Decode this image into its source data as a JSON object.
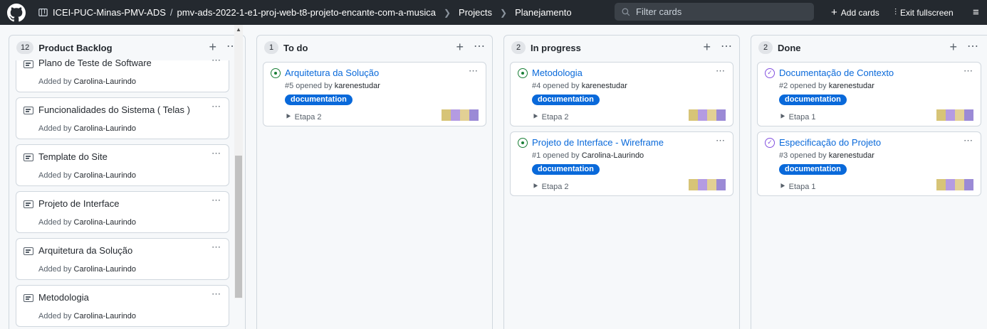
{
  "header": {
    "org": "ICEI-PUC-Minas-PMV-ADS",
    "separator": "/",
    "repo": "pmv-ads-2022-1-e1-proj-web-t8-projeto-encante-com-a-musica",
    "section": "Projects",
    "board": "Planejamento",
    "filter_placeholder": "Filter cards",
    "add_cards": "Add cards",
    "exit_fullscreen": "Exit fullscreen"
  },
  "icons": {
    "logo": "github-logo-icon",
    "project": "project-icon",
    "search": "search-icon",
    "plus": "plus-icon",
    "exit": "exit-fullscreen-icon",
    "menu": "menu-icon"
  },
  "colors": {
    "header_bg": "#24292f",
    "link_blue": "#0969da",
    "open_green": "#1a7f37",
    "closed_purple": "#8250df",
    "label_bg": "#0969da"
  },
  "columns": [
    {
      "count": "12",
      "title": "Product Backlog",
      "notes": [
        {
          "title": "Plano de Teste de Software",
          "added": "Added by",
          "author": "Carolina-Laurindo"
        },
        {
          "title": "Funcionalidades do Sistema ( Telas )",
          "added": "Added by",
          "author": "Carolina-Laurindo"
        },
        {
          "title": "Template do Site",
          "added": "Added by",
          "author": "Carolina-Laurindo"
        },
        {
          "title": "Projeto de Interface",
          "added": "Added by",
          "author": "Carolina-Laurindo"
        },
        {
          "title": "Arquitetura da Solução",
          "added": "Added by",
          "author": "Carolina-Laurindo"
        },
        {
          "title": "Metodologia",
          "added": "Added by",
          "author": "Carolina-Laurindo"
        }
      ]
    },
    {
      "count": "1",
      "title": "To do",
      "issues": [
        {
          "title": "Arquitetura da Solução",
          "number": "#5 opened by",
          "author": "karenestudar",
          "label": "documentation",
          "milestone": "Etapa 2",
          "state": "open"
        }
      ]
    },
    {
      "count": "2",
      "title": "In progress",
      "issues": [
        {
          "title": "Metodologia",
          "number": "#4 opened by",
          "author": "karenestudar",
          "label": "documentation",
          "milestone": "Etapa 2",
          "state": "open"
        },
        {
          "title": "Projeto de Interface - Wireframe",
          "number": "#1 opened by",
          "author": "Carolina-Laurindo",
          "label": "documentation",
          "milestone": "Etapa 2",
          "state": "open"
        }
      ]
    },
    {
      "count": "2",
      "title": "Done",
      "issues": [
        {
          "title": "Documentação de Contexto",
          "number": "#2 opened by",
          "author": "karenestudar",
          "label": "documentation",
          "milestone": "Etapa 1",
          "state": "closed"
        },
        {
          "title": "Especificação do Projeto",
          "number": "#3 opened by",
          "author": "karenestudar",
          "label": "documentation",
          "milestone": "Etapa 1",
          "state": "closed"
        }
      ]
    }
  ]
}
